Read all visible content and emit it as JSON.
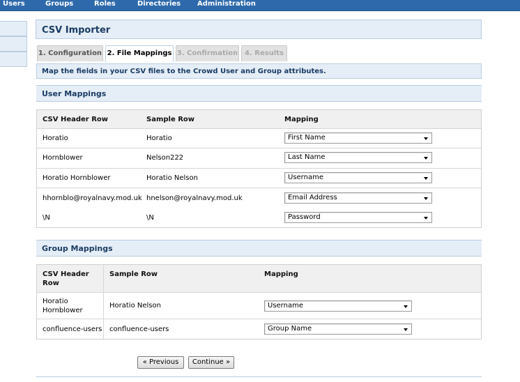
{
  "topnav": {
    "items": [
      {
        "label": "Users"
      },
      {
        "label": "Groups"
      },
      {
        "label": "Roles"
      },
      {
        "label": "Directories"
      },
      {
        "label": "Administration"
      }
    ]
  },
  "page": {
    "title": "CSV Importer",
    "info": "Map the fields in your CSV files to the Crowd User and Group attributes."
  },
  "tabs": [
    {
      "label": "1. Configuration",
      "state": "enabled"
    },
    {
      "label": "2. File Mappings",
      "state": "active"
    },
    {
      "label": "3. Confirmation",
      "state": "disabled"
    },
    {
      "label": "4. Results",
      "state": "disabled"
    }
  ],
  "user_mappings": {
    "title": "User Mappings",
    "headers": {
      "csv": "CSV Header Row",
      "sample": "Sample Row",
      "mapping": "Mapping"
    },
    "rows": [
      {
        "csv": "Horatio",
        "sample": "Horatio",
        "mapping": "First Name"
      },
      {
        "csv": "Hornblower",
        "sample": "Nelson222",
        "mapping": "Last Name"
      },
      {
        "csv": "Horatio Hornblower",
        "sample": "Horatio Nelson",
        "mapping": "Username"
      },
      {
        "csv": "hhornblo@royalnavy.mod.uk",
        "sample": "hnelson@royalnavy.mod.uk",
        "mapping": "Email Address"
      },
      {
        "csv": "\\N",
        "sample": "\\N",
        "mapping": "Password"
      }
    ]
  },
  "group_mappings": {
    "title": "Group Mappings",
    "headers": {
      "csv_line1": "CSV Header",
      "csv_line2": "Row",
      "sample": "Sample Row",
      "mapping": "Mapping"
    },
    "rows": [
      {
        "csv_line1": "Horatio",
        "csv_line2": "Hornblower",
        "sample": "Horatio Nelson",
        "mapping": "Username"
      },
      {
        "csv_line1": "confluence-users",
        "csv_line2": "",
        "sample": "confluence-users",
        "mapping": "Group Name"
      }
    ]
  },
  "buttons": {
    "previous": "« Previous",
    "continue": "Continue »"
  },
  "colors": {
    "nav": "#2e6aab",
    "panel": "#e5eef7",
    "border": "#b9cde2",
    "heading_text": "#1a3b63"
  }
}
